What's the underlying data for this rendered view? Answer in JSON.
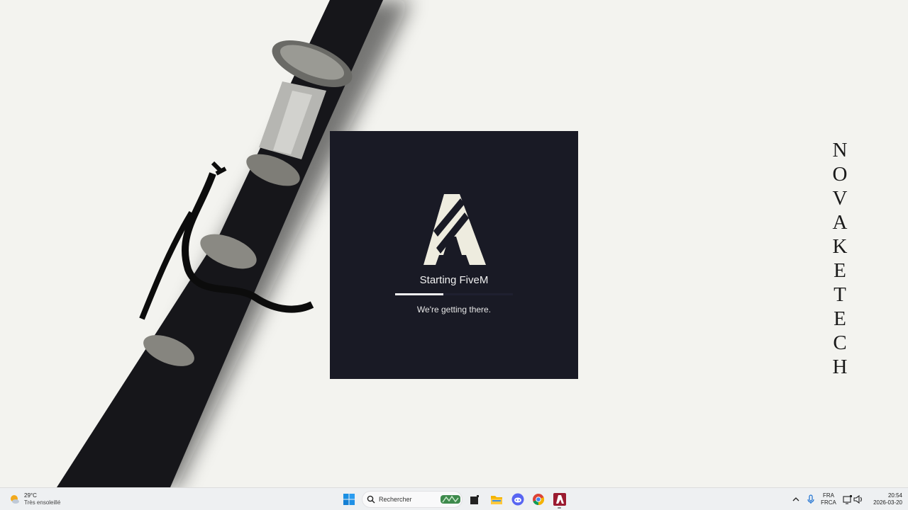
{
  "desktop": {
    "vertical_letters": [
      "N",
      "O",
      "V",
      "A",
      "K",
      "E",
      "T",
      "E",
      "C",
      "H"
    ]
  },
  "splash": {
    "title": "Starting FiveM",
    "subtitle": "We're getting there.",
    "progress_percent": 41,
    "background": "#191a25",
    "logo_color": "#eeecdf"
  },
  "taskbar": {
    "weather": {
      "temp": "29°C",
      "desc": "Très ensoleillé",
      "icon": "sun-cloud-icon"
    },
    "search": {
      "placeholder": "Rechercher"
    },
    "pinned": [
      {
        "name": "start-button",
        "icon": "windows-icon"
      },
      {
        "name": "task-view-button",
        "icon": "task-view-icon"
      },
      {
        "name": "file-explorer-button",
        "icon": "folder-icon"
      },
      {
        "name": "discord-button",
        "icon": "discord-icon"
      },
      {
        "name": "chrome-button",
        "icon": "chrome-icon"
      },
      {
        "name": "fivem-button",
        "icon": "fivem-icon"
      }
    ],
    "tray": {
      "lang_top": "FRA",
      "lang_bottom": "FRCA",
      "time": "20:54",
      "date": "2026-03-20"
    }
  }
}
